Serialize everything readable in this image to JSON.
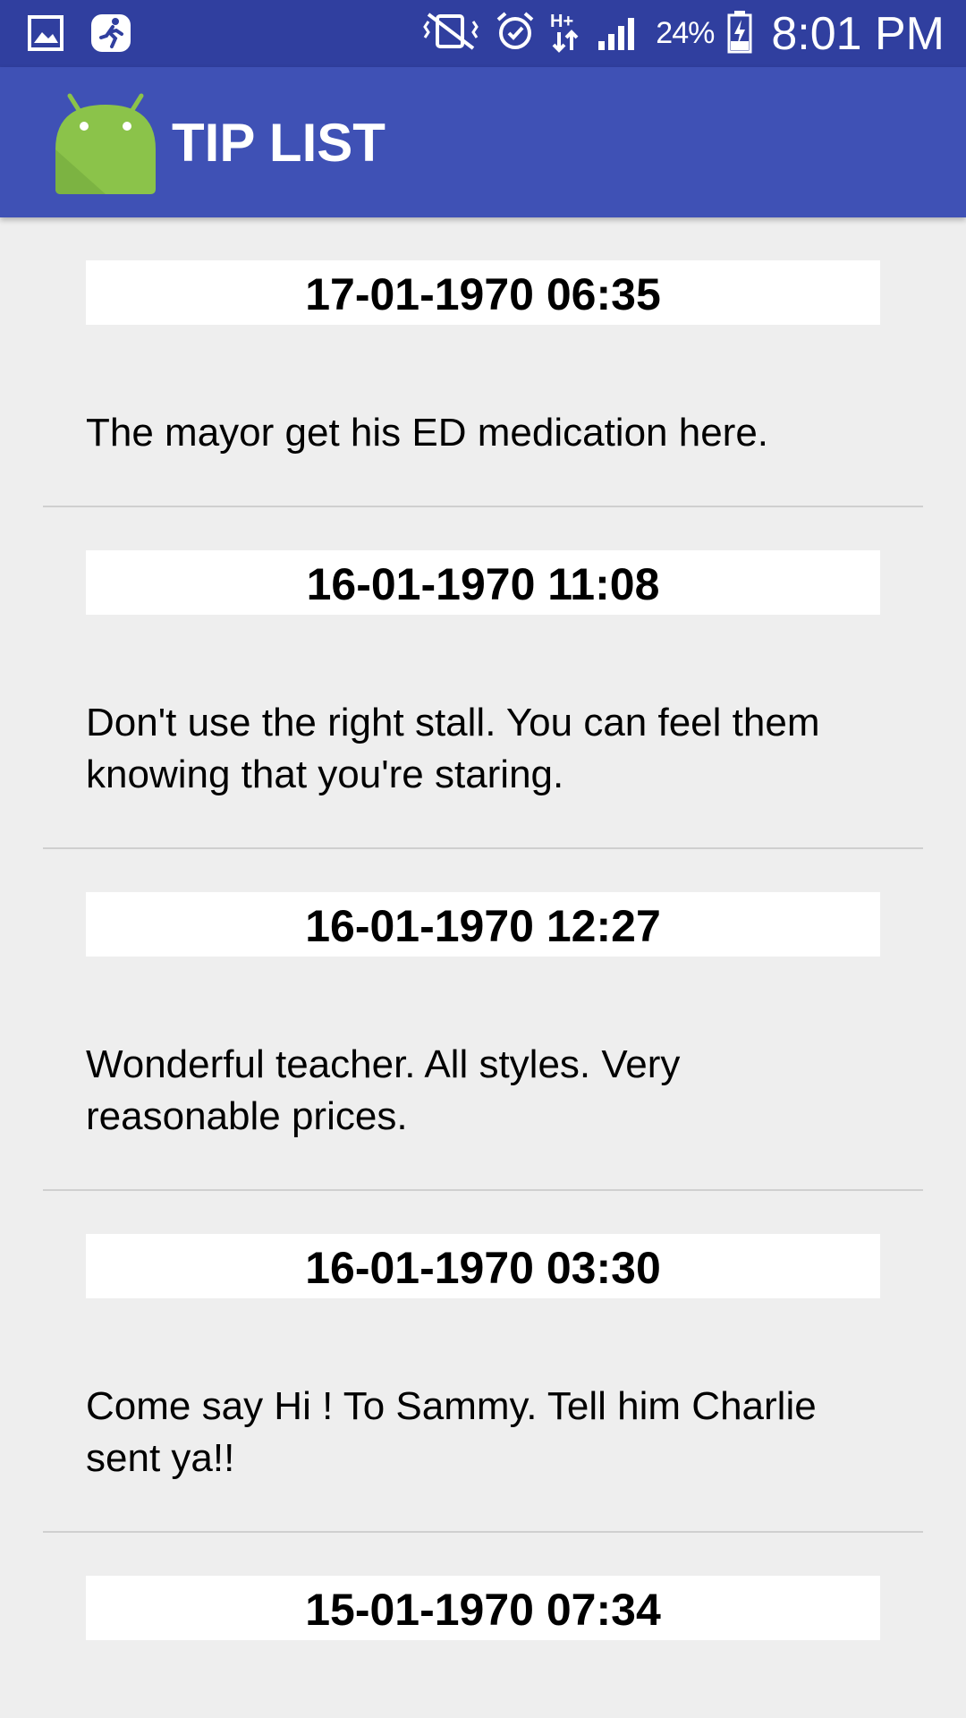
{
  "status_bar": {
    "icons_left": [
      "gallery-icon",
      "running-man-icon"
    ],
    "icons_right": [
      "vibrate-mute-icon",
      "alarm-icon",
      "hplus-data-icon",
      "signal-icon",
      "battery-charging-icon"
    ],
    "battery": "24%",
    "time": "8:01 PM"
  },
  "app_bar": {
    "title": "TIP LIST",
    "logo": "android-robot-icon"
  },
  "colors": {
    "status_bar": "#303f9f",
    "app_bar": "#3f51b5",
    "background": "#eeeeee",
    "android_green": "#8bc34a"
  },
  "tips": [
    {
      "date": "17-01-1970 06:35",
      "text": "The mayor get his ED medication here."
    },
    {
      "date": "16-01-1970 11:08",
      "text": "Don't use the right stall. You can feel them knowing that you're staring."
    },
    {
      "date": "16-01-1970 12:27",
      "text": "Wonderful teacher. All styles. Very reasonable prices."
    },
    {
      "date": "16-01-1970 03:30",
      "text": "Come say Hi ! To Sammy.  Tell him Charlie sent ya!!"
    },
    {
      "date": "15-01-1970 07:34",
      "text": ""
    }
  ]
}
